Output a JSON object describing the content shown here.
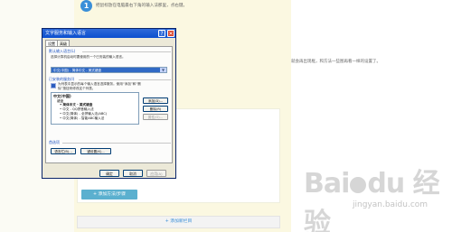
{
  "article": {
    "step_number": "1",
    "step_text": "把鼠标放在电脑最右下角的输入法那里，点右键。",
    "line_text": "就会再出现框，和方法一些图再看一样的设置了。",
    "add_method_button": "+ 添加方法/步骤",
    "add_column_button": "+ 添加新栏目",
    "watermark": "Baidu经验",
    "watermark_url": "jingyan.baidu.com"
  },
  "dialog": {
    "title": "文字服务和输入语言",
    "help_glyph": "?",
    "close_glyph": "✕",
    "tabs": [
      "设置",
      "高级"
    ],
    "default_lang_title": "默认输入语言(L)",
    "default_lang_desc": "选择计算机启动时要使用的一个已安装的输入语言。",
    "default_lang_value": "中文(中国) - 简体中文 - 美式键盘",
    "installed_title": "已安装的服务(I)",
    "installed_desc1": "为列表中显示的每个输入语言选择服务。使用“添加”和“删",
    "installed_desc2": "除”按钮来修改这个列表。",
    "services": {
      "language": "中文(中国)",
      "keyboard_group": "键盘",
      "items": [
        "• 简体中文 - 美式键盘",
        "• 中文 - QQ拼音输入法",
        "• 中文(简体) - 全拼输入法(ABC)",
        "• 中文(简体) - 智能ABC输入法"
      ]
    },
    "add_button": "添加(D)...",
    "remove_button": "删除(R)",
    "properties_button": "属性(O)...",
    "prefs_title": "首选项",
    "langbar_button": "语言栏(B)...",
    "keys_button": "键设置(K)...",
    "ok_button": "确定",
    "cancel_button": "取消",
    "apply_button": "应用(A)"
  },
  "colors": {
    "titlebar": "#0c4fcf",
    "selection": "#316ac5",
    "group_title": "#1a50c0"
  }
}
